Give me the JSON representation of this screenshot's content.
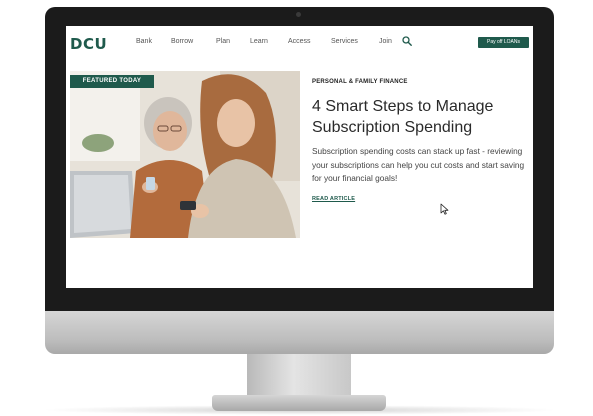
{
  "site": {
    "logo_text": "DCU",
    "nav": [
      "Bank",
      "Borrow",
      "Plan",
      "Learn",
      "Access",
      "Services",
      "Join"
    ],
    "pay_button": "Pay off LOANs"
  },
  "featured": {
    "badge": "FEATURED TODAY",
    "category": "PERSONAL & FAMILY FINANCE",
    "title": "4 Smart Steps to Manage Subscription Spending",
    "excerpt": "Subscription spending costs can stack up fast - reviewing your subscriptions can help you cut costs and start saving for your financial goals!",
    "link": "READ ARTICLE"
  },
  "colors": {
    "brand_green": "#1f5a4c",
    "bezel": "#1b1b1b",
    "chin_silver": "#c4c4c4"
  },
  "icons": [
    "camera-dot",
    "search-icon",
    "cursor-icon"
  ]
}
